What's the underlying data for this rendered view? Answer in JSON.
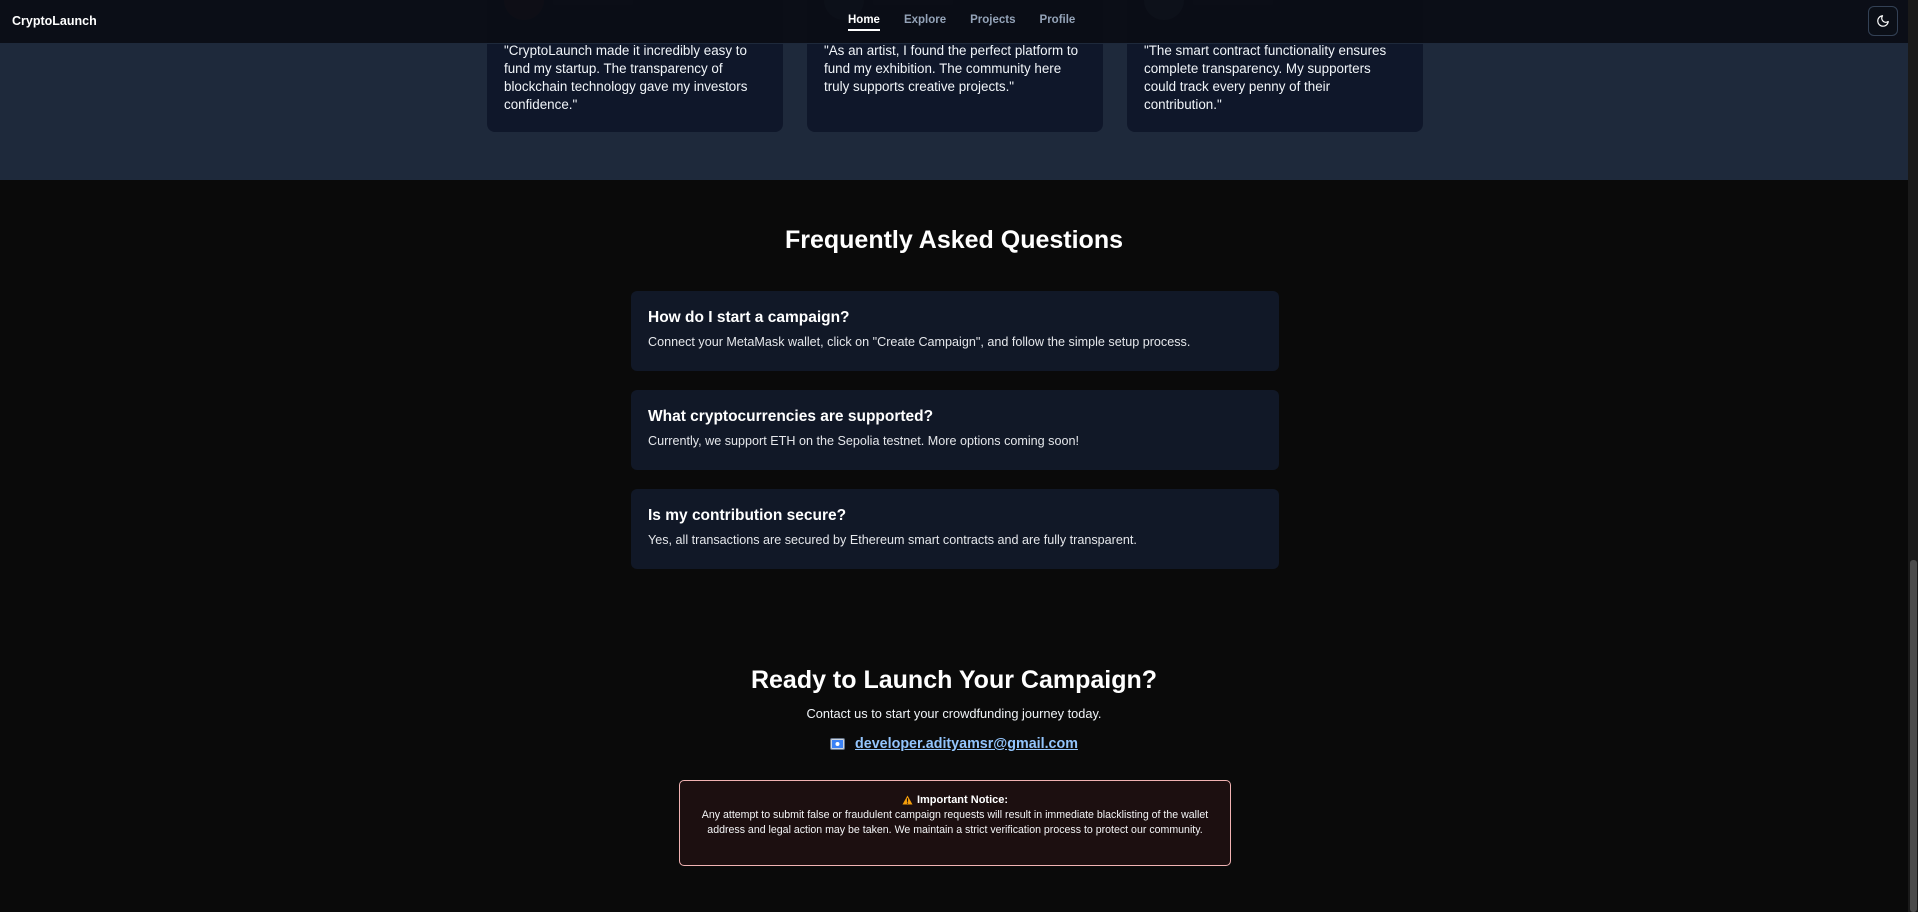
{
  "header": {
    "logo": "CryptoLaunch",
    "nav": [
      {
        "label": "Home",
        "active": true
      },
      {
        "label": "Explore",
        "active": false
      },
      {
        "label": "Projects",
        "active": false
      },
      {
        "label": "Profile",
        "active": false
      }
    ],
    "theme_icon": "moon-icon"
  },
  "testimonials": [
    {
      "quote": "\"CryptoLaunch made it incredibly easy to fund my startup. The transparency of blockchain technology gave my investors confidence.\"",
      "avatar_color": "#c2410c"
    },
    {
      "quote": "\"As an artist, I found the perfect platform to fund my exhibition. The community here truly supports creative projects.\"",
      "avatar_color": "#64748b"
    },
    {
      "quote": "\"The smart contract functionality ensures complete transparency. My supporters could track every penny of their contribution.\"",
      "avatar_color": "#94a3b8"
    }
  ],
  "faq": {
    "title": "Frequently Asked Questions",
    "items": [
      {
        "q": "How do I start a campaign?",
        "a": "Connect your MetaMask wallet, click on \"Create Campaign\", and follow the simple setup process."
      },
      {
        "q": "What cryptocurrencies are supported?",
        "a": "Currently, we support ETH on the Sepolia testnet. More options coming soon!"
      },
      {
        "q": "Is my contribution secure?",
        "a": "Yes, all transactions are secured by Ethereum smart contracts and are fully transparent."
      }
    ]
  },
  "cta": {
    "title": "Ready to Launch Your Campaign?",
    "subtitle": "Contact us to start your crowdfunding journey today.",
    "email": "developer.adityamsr@gmail.com",
    "email_icon": "mail-icon"
  },
  "notice": {
    "icon": "warning-icon",
    "heading": "Important Notice:",
    "body": "Any attempt to submit false or fraudulent campaign requests will result in immediate blacklisting of the wallet address and legal action may be taken. We maintain a strict verification process to protect our community."
  },
  "colors": {
    "background": "#0a0a0a",
    "band": "#1e293b",
    "card": "#111827",
    "link": "#93c5fd",
    "notice_border": "#f1b3b3"
  }
}
